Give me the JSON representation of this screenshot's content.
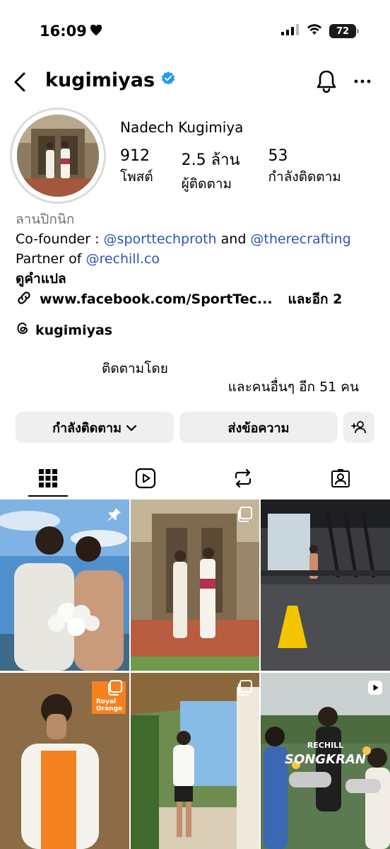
{
  "status_bar": {
    "time": "16:09",
    "battery": "72"
  },
  "header": {
    "username": "kugimiyas"
  },
  "profile": {
    "full_name": "Nadech Kugimiya",
    "stats": [
      {
        "value": "912",
        "label": "โพสต์"
      },
      {
        "value": "2.5 ล้าน",
        "label": "ผู้ติดตาม"
      },
      {
        "value": "53",
        "label": "กำลังติดตาม"
      }
    ],
    "category": "ลานปิกนิก",
    "bio_line1_prefix": "Co-founder : ",
    "bio_mention1": "@sporttechproth",
    "bio_and": " and ",
    "bio_mention2": "@therecrafting",
    "bio_line2_prefix": "Partner of ",
    "bio_mention3": "@rechill.co",
    "translate": "ดูคำแปล",
    "link": "www.facebook.com/SportTec...",
    "link_more": "และอีก 2",
    "threads": "kugimiyas",
    "followed_by": "ติดตามโดย",
    "followed_by_more": "และคนอื่นๆ อีก 51 คน"
  },
  "actions": {
    "following": "กำลังติดตาม",
    "message": "ส่งข้อความ"
  },
  "grid": {
    "posts": [
      {
        "badge": "pin-icon"
      },
      {
        "badge": "carousel-icon"
      },
      {
        "badge": ""
      },
      {
        "badge": "carousel-icon",
        "text": "Royal Orange"
      },
      {
        "badge": "carousel-icon"
      },
      {
        "badge": "reel-icon",
        "text": "SONGKRAN",
        "brand": "RECHILL"
      }
    ]
  },
  "colors": {
    "mention": "#2e54b8",
    "button_bg": "#efefef",
    "verified": "#1d9bf0"
  }
}
